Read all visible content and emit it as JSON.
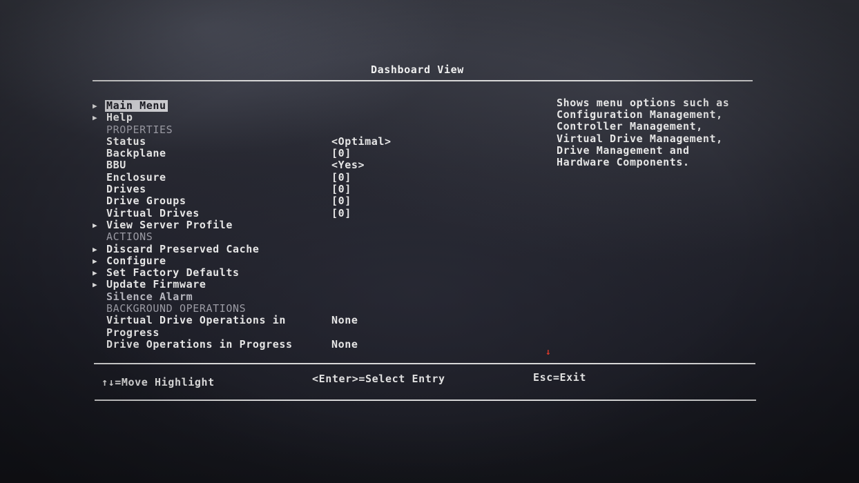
{
  "title": "Dashboard View",
  "menu": {
    "main_menu": "Main Menu",
    "help": "Help",
    "properties_header": "PROPERTIES",
    "status_label": "Status",
    "status_value": "<Optimal>",
    "backplane_label": "Backplane",
    "backplane_value": "[0]",
    "bbu_label": "BBU",
    "bbu_value": "<Yes>",
    "enclosure_label": "Enclosure",
    "enclosure_value": "[0]",
    "drives_label": "Drives",
    "drives_value": "[0]",
    "drive_groups_label": "Drive Groups",
    "drive_groups_value": "[0]",
    "virtual_drives_label": "Virtual Drives",
    "virtual_drives_value": "[0]",
    "view_server_profile": "View Server Profile",
    "actions_header": "ACTIONS",
    "discard_preserved_cache": "Discard Preserved Cache",
    "configure": "Configure",
    "set_factory_defaults": "Set Factory Defaults",
    "update_firmware": "Update Firmware",
    "silence_alarm": "Silence Alarm",
    "background_header": "BACKGROUND OPERATIONS",
    "vd_ops_label_line1": "Virtual Drive Operations in",
    "vd_ops_label_line2": "Progress",
    "vd_ops_value": "None",
    "drive_ops_label": "Drive Operations in Progress",
    "drive_ops_value": "None"
  },
  "help_text": [
    "Shows menu options such as",
    "Configuration Management,",
    "Controller Management,",
    "Virtual Drive Management,",
    "Drive Management and",
    "Hardware Components."
  ],
  "footer": {
    "move": "↑↓=Move Highlight",
    "select": "<Enter>=Select Entry",
    "exit": "Esc=Exit"
  },
  "colors": {
    "highlight_bg": "#d4d4d8",
    "text": "#e6e6e6",
    "section_text": "#9b9ba4"
  },
  "icons": {
    "submenu": "triangle-right-icon"
  }
}
